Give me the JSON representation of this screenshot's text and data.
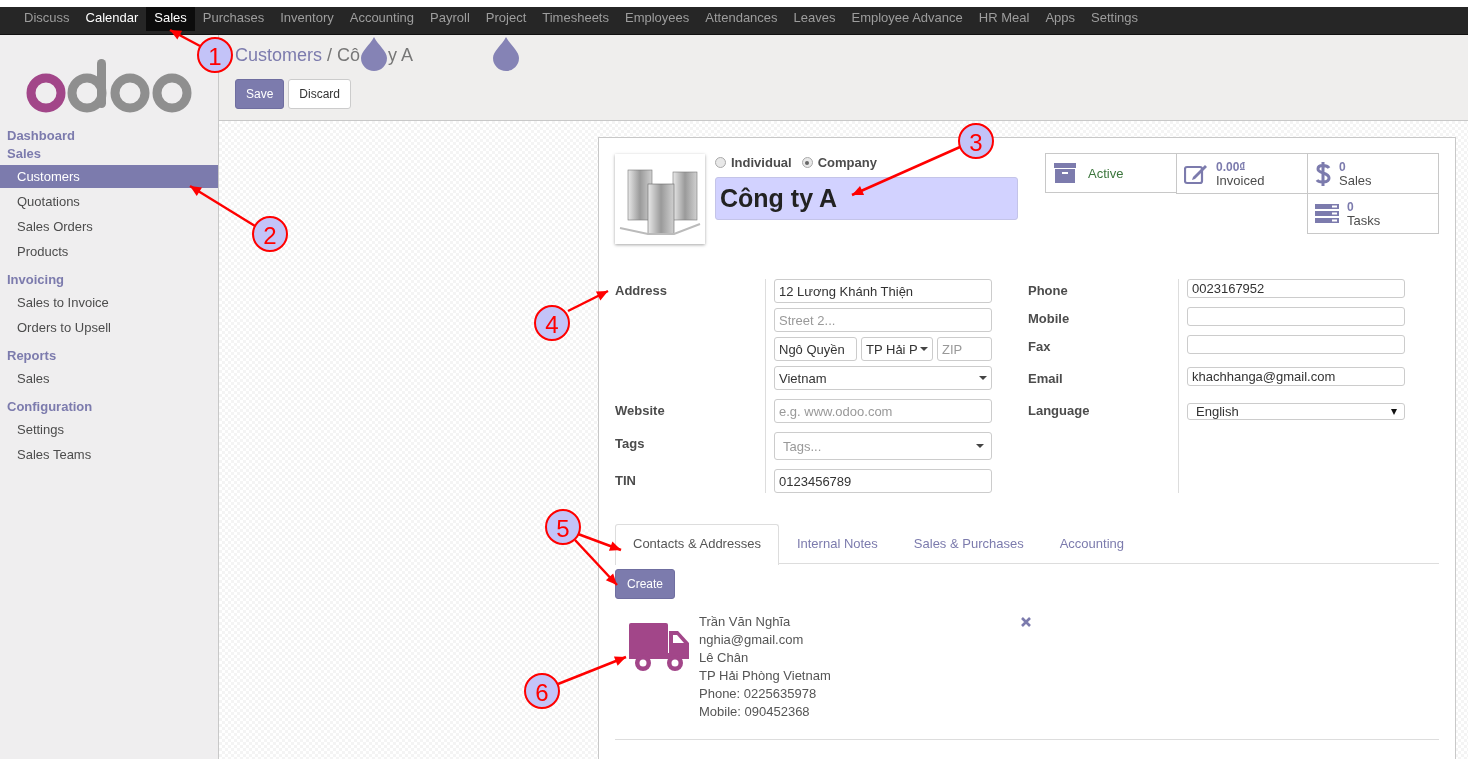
{
  "top_menu": [
    {
      "label": "Discuss",
      "selected": false,
      "highlighted": false
    },
    {
      "label": "Calendar",
      "selected": false,
      "highlighted": true
    },
    {
      "label": "Sales",
      "selected": true,
      "highlighted": false
    },
    {
      "label": "Purchases",
      "selected": false,
      "highlighted": false
    },
    {
      "label": "Inventory",
      "selected": false,
      "highlighted": false
    },
    {
      "label": "Accounting",
      "selected": false,
      "highlighted": false
    },
    {
      "label": "Payroll",
      "selected": false,
      "highlighted": false
    },
    {
      "label": "Project",
      "selected": false,
      "highlighted": false
    },
    {
      "label": "Timesheets",
      "selected": false,
      "highlighted": false
    },
    {
      "label": "Employees",
      "selected": false,
      "highlighted": false
    },
    {
      "label": "Attendances",
      "selected": false,
      "highlighted": false
    },
    {
      "label": "Leaves",
      "selected": false,
      "highlighted": false
    },
    {
      "label": "Employee Advance",
      "selected": false,
      "highlighted": false
    },
    {
      "label": "HR Meal",
      "selected": false,
      "highlighted": false
    },
    {
      "label": "Apps",
      "selected": false,
      "highlighted": false
    },
    {
      "label": "Settings",
      "selected": false,
      "highlighted": false
    }
  ],
  "sidebar": {
    "sections": [
      {
        "title": "Dashboard"
      },
      {
        "title": "Sales",
        "items": [
          {
            "label": "Customers",
            "selected": true
          },
          {
            "label": "Quotations",
            "selected": false
          },
          {
            "label": "Sales Orders",
            "selected": false
          },
          {
            "label": "Products",
            "selected": false
          }
        ]
      },
      {
        "title": "Invoicing",
        "items": [
          {
            "label": "Sales to Invoice",
            "selected": false
          },
          {
            "label": "Orders to Upsell",
            "selected": false
          }
        ]
      },
      {
        "title": "Reports",
        "items": [
          {
            "label": "Sales",
            "selected": false
          }
        ]
      },
      {
        "title": "Configuration",
        "items": [
          {
            "label": "Settings",
            "selected": false
          },
          {
            "label": "Sales Teams",
            "selected": false
          }
        ]
      }
    ]
  },
  "breadcrumb": {
    "parent": "Customers",
    "separator": "/",
    "current_parts": [
      "Cô",
      "y A"
    ]
  },
  "buttons": [
    {
      "label": "Save",
      "kind": "primary"
    },
    {
      "label": "Discard",
      "kind": "secondary"
    }
  ],
  "company_type": [
    {
      "label": "Individual",
      "selected": false
    },
    {
      "label": "Company",
      "selected": true
    }
  ],
  "name": "Công ty A",
  "stat_buttons": [
    {
      "kind": "toggle",
      "label": "Active"
    },
    {
      "kind": "stat",
      "value": "0.00₫",
      "label": "Invoiced"
    },
    {
      "kind": "stat",
      "value": "0",
      "label": "Sales"
    },
    {
      "kind": "stat",
      "value": "0",
      "label": "Tasks"
    }
  ],
  "form_left": [
    {
      "label": "Address",
      "rows": [
        [
          {
            "kind": "text",
            "value": "12 Lương Khánh Thiện"
          }
        ],
        [
          {
            "kind": "text",
            "placeholder": "Street 2..."
          }
        ],
        [
          {
            "kind": "text",
            "value": "Ngô Quyền"
          },
          {
            "kind": "select",
            "value": "TP Hải P"
          },
          {
            "kind": "text",
            "placeholder": "ZIP"
          }
        ],
        [
          {
            "kind": "select",
            "value": "Vietnam"
          }
        ]
      ]
    },
    {
      "label": "Website",
      "rows": [
        [
          {
            "kind": "text",
            "placeholder": "e.g. www.odoo.com"
          }
        ]
      ]
    },
    {
      "label": "Tags",
      "rows": [
        [
          {
            "kind": "tags",
            "placeholder": "Tags..."
          }
        ]
      ]
    },
    {
      "label": "TIN",
      "rows": [
        [
          {
            "kind": "text",
            "value": "0123456789"
          }
        ]
      ]
    }
  ],
  "form_right": [
    {
      "label": "Phone",
      "field": {
        "kind": "text",
        "value": "0023167952"
      }
    },
    {
      "label": "Mobile",
      "field": {
        "kind": "text"
      }
    },
    {
      "label": "Fax",
      "field": {
        "kind": "text"
      }
    },
    {
      "label": "Email",
      "field": {
        "kind": "text",
        "value": "khachhanga@gmail.com"
      }
    },
    {
      "label": "Language",
      "field": {
        "kind": "native",
        "value": "English"
      }
    }
  ],
  "tabs": [
    {
      "label": "Contacts & Addresses",
      "selected": true
    },
    {
      "label": "Internal Notes",
      "selected": false
    },
    {
      "label": "Sales & Purchases",
      "selected": false
    },
    {
      "label": "Accounting",
      "selected": false
    }
  ],
  "create_button": "Create",
  "contacts": [
    {
      "lines": [
        "Trần Văn Nghĩa",
        "nghia@gmail.com",
        "Lê Chân",
        "TP Hải Phòng Vietnam",
        "Phone: 0225635978",
        "Mobile: 090452368"
      ]
    }
  ],
  "callouts": [
    {
      "number": "1"
    },
    {
      "number": "2"
    },
    {
      "number": "3"
    },
    {
      "number": "4"
    },
    {
      "number": "5"
    },
    {
      "number": "6"
    }
  ]
}
